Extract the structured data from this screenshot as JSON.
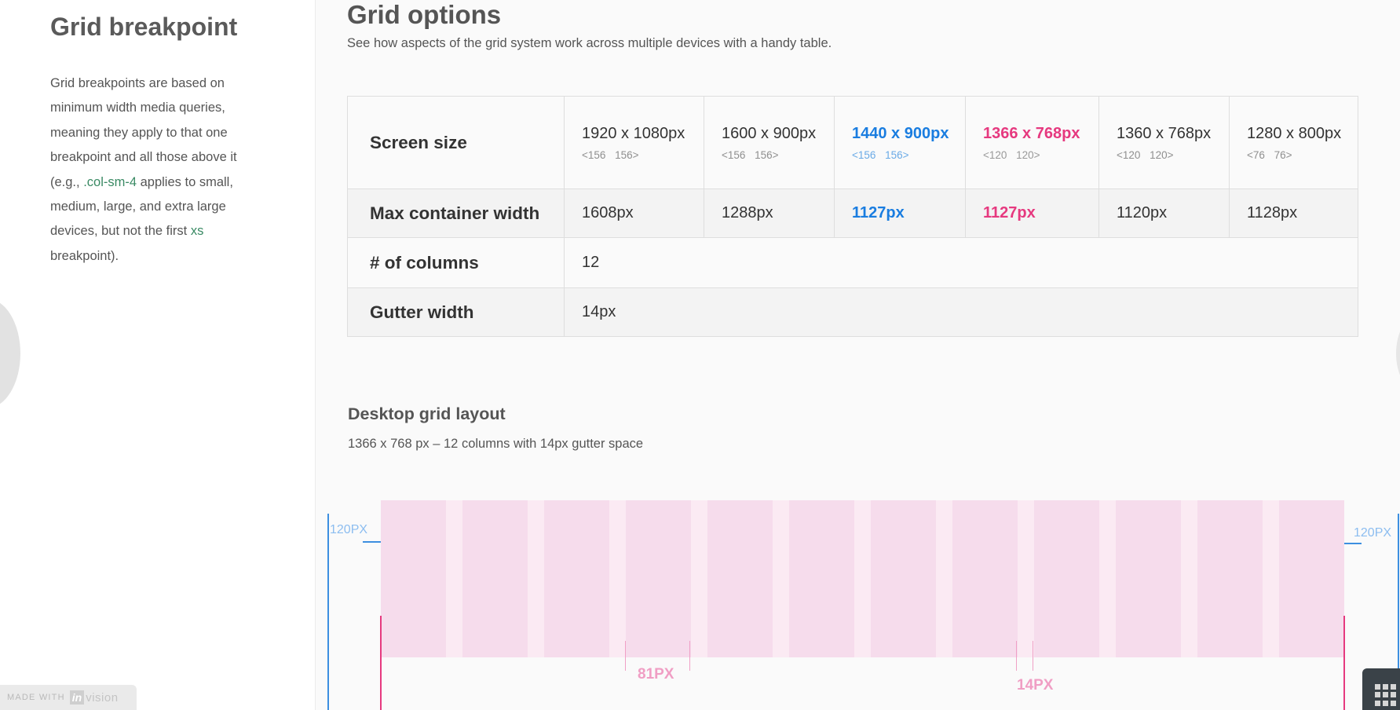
{
  "sidebar": {
    "title": "Grid breakpoint",
    "text_a": "Grid breakpoints are based on minimum width media queries, meaning they apply to that one breakpoint and all those above it (e.g., ",
    "code1": ".col-sm-4",
    "text_b": " applies to small, medium, large, and extra large devices, but not the first ",
    "code2": "xs",
    "text_c": " breakpoint).",
    "made_with": "MADE WITH",
    "logo_in": "in",
    "logo_vision": "vision"
  },
  "main": {
    "title": "Grid options",
    "subtitle": "See how aspects of the grid system work across multiple devices with a handy table."
  },
  "table": {
    "row_labels": {
      "screen": "Screen size",
      "max": "Max container width",
      "cols": "# of columns",
      "gutter": "Gutter width"
    },
    "screens": [
      {
        "size": "1920 x 1080px",
        "margins": "<156 156>",
        "max": "1608px"
      },
      {
        "size": "1600 x 900px",
        "margins": "<156 156>",
        "max": "1288px"
      },
      {
        "size": "1440 x 900px",
        "margins": "<156 156>",
        "max": "1127px"
      },
      {
        "size": "1366 x 768px",
        "margins": "<120 120>",
        "max": "1127px"
      },
      {
        "size": "1360 x 768px",
        "margins": "<120 120>",
        "max": "1120px"
      },
      {
        "size": "1280 x 800px",
        "margins": "<76 76>",
        "max": "1128px"
      }
    ],
    "columns": "12",
    "gutter": "14px"
  },
  "desktop": {
    "title": "Desktop grid layout",
    "subtitle": "1366 x 768 px – 12 columns with 14px gutter space",
    "left_margin_label": "120PX",
    "right_margin_label": "120PX",
    "column_width_label": "81PX",
    "gutter_label": "14PX",
    "column_count": 12
  },
  "colors": {
    "blue": "#1a7de0",
    "pink": "#e6397f",
    "column": "#f6dcec",
    "gutter": "#fbeaf3"
  },
  "icons": {
    "apps": "grid-menu-icon"
  }
}
